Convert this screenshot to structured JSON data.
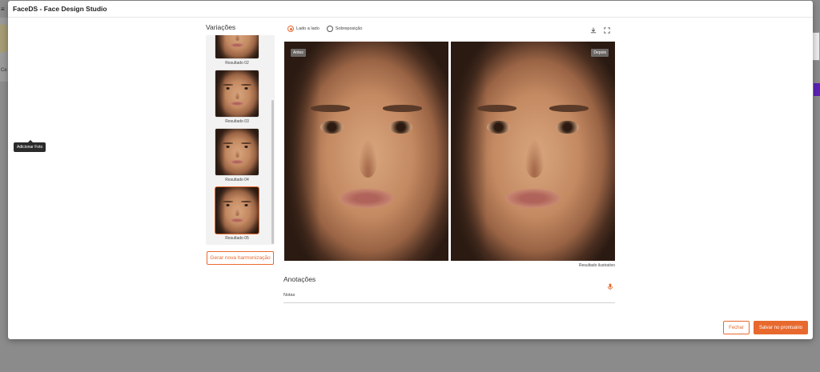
{
  "background": {
    "menu_glyph": "≡",
    "left_fragment": "Ce"
  },
  "tooltip": {
    "text": "Adicionar Foto"
  },
  "modal": {
    "title": "FaceDS - Face Design Studio"
  },
  "variations": {
    "title": "Variações",
    "items": [
      {
        "label": "Resultado 02",
        "selected": false
      },
      {
        "label": "Resultado 03",
        "selected": false
      },
      {
        "label": "Resultado 04",
        "selected": false
      },
      {
        "label": "Resultado 05",
        "selected": true
      }
    ],
    "generate_button": "Gerar nova harmonização"
  },
  "compare": {
    "modes": [
      {
        "label": "Lado a lado",
        "checked": true
      },
      {
        "label": "Sobreposição",
        "checked": false
      }
    ],
    "tools": [
      "download-icon",
      "fullscreen-icon"
    ],
    "before_label": "Antes",
    "after_label": "Depois",
    "caption": "Resultado ilustrativo"
  },
  "annotations": {
    "title": "Anotações",
    "notes_label": "Notas",
    "notes_value": ""
  },
  "footer": {
    "close_label": "Fechar",
    "save_label": "Salvar no prontuário"
  },
  "colors": {
    "accent": "#e8692e",
    "overlay": "#8b8b8b"
  }
}
